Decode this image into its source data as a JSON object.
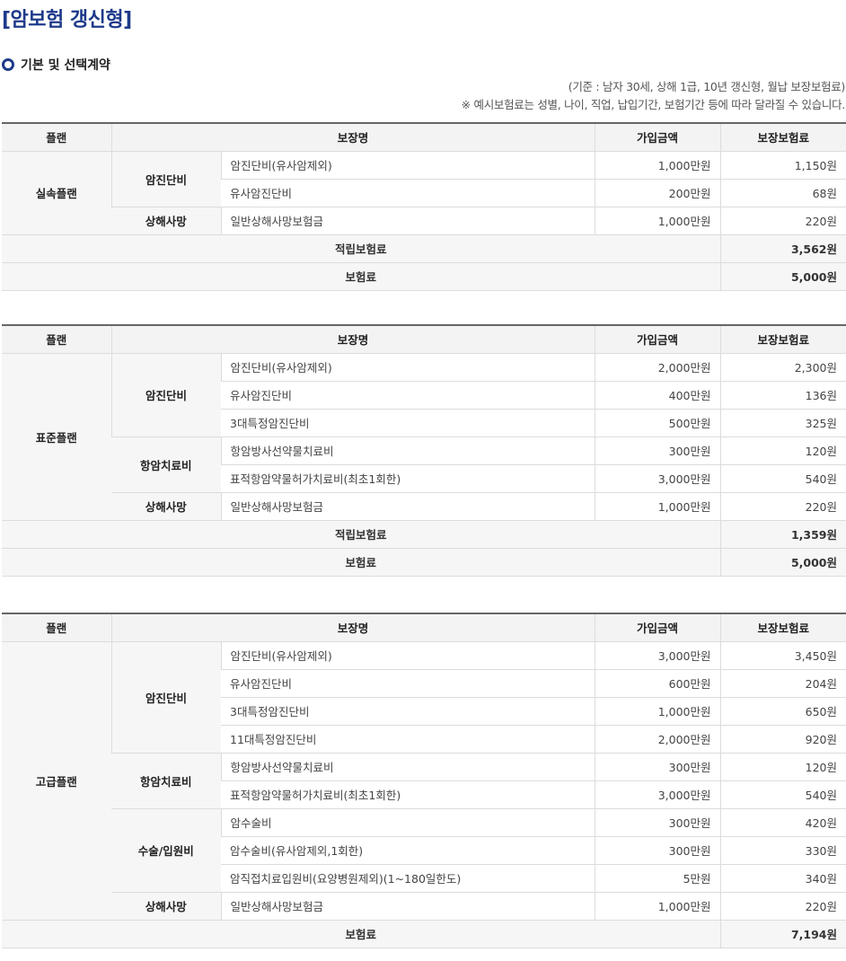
{
  "page_title": "[암보험 갱신형]",
  "section_label": "기본 및 선택계약",
  "note_basis": "(기준 : 남자 30세, 상해 1급, 10년 갱신형, 월납 보장보험료)",
  "note_disclaimer": "※ 예시보험료는 성별, 나이, 직업, 납입기간, 보험기간 등에 따라 달라질 수 있습니다.",
  "headers": {
    "plan": "플랜",
    "coverage": "보장명",
    "amount": "가입금액",
    "premium": "보장보험료"
  },
  "plans": [
    {
      "name": "실속플랜",
      "groups": [
        {
          "category": "암진단비",
          "items": [
            {
              "coverage": "암진단비(유사암제외)",
              "amount": "1,000만원",
              "premium": "1,150원"
            },
            {
              "coverage": "유사암진단비",
              "amount": "200만원",
              "premium": "68원"
            }
          ]
        },
        {
          "category": "상해사망",
          "items": [
            {
              "coverage": "일반상해사망보험금",
              "amount": "1,000만원",
              "premium": "220원"
            }
          ]
        }
      ],
      "totals": [
        {
          "label": "적립보험료",
          "value": "3,562원"
        },
        {
          "label": "보험료",
          "value": "5,000원"
        }
      ]
    },
    {
      "name": "표준플랜",
      "groups": [
        {
          "category": "암진단비",
          "items": [
            {
              "coverage": "암진단비(유사암제외)",
              "amount": "2,000만원",
              "premium": "2,300원"
            },
            {
              "coverage": "유사암진단비",
              "amount": "400만원",
              "premium": "136원"
            },
            {
              "coverage": "3대특정암진단비",
              "amount": "500만원",
              "premium": "325원"
            }
          ]
        },
        {
          "category": "항암치료비",
          "items": [
            {
              "coverage": "항암방사선약물치료비",
              "amount": "300만원",
              "premium": "120원"
            },
            {
              "coverage": "표적항암약물허가치료비(최초1회한)",
              "amount": "3,000만원",
              "premium": "540원"
            }
          ]
        },
        {
          "category": "상해사망",
          "items": [
            {
              "coverage": "일반상해사망보험금",
              "amount": "1,000만원",
              "premium": "220원"
            }
          ]
        }
      ],
      "totals": [
        {
          "label": "적립보험료",
          "value": "1,359원"
        },
        {
          "label": "보험료",
          "value": "5,000원"
        }
      ]
    },
    {
      "name": "고급플랜",
      "groups": [
        {
          "category": "암진단비",
          "items": [
            {
              "coverage": "암진단비(유사암제외)",
              "amount": "3,000만원",
              "premium": "3,450원"
            },
            {
              "coverage": "유사암진단비",
              "amount": "600만원",
              "premium": "204원"
            },
            {
              "coverage": "3대특정암진단비",
              "amount": "1,000만원",
              "premium": "650원"
            },
            {
              "coverage": "11대특정암진단비",
              "amount": "2,000만원",
              "premium": "920원"
            }
          ]
        },
        {
          "category": "항암치료비",
          "items": [
            {
              "coverage": "항암방사선약물치료비",
              "amount": "300만원",
              "premium": "120원"
            },
            {
              "coverage": "표적항암약물허가치료비(최초1회한)",
              "amount": "3,000만원",
              "premium": "540원"
            }
          ]
        },
        {
          "category": "수술/입원비",
          "items": [
            {
              "coverage": "암수술비",
              "amount": "300만원",
              "premium": "420원"
            },
            {
              "coverage": "암수술비(유사암제외,1회한)",
              "amount": "300만원",
              "premium": "330원"
            },
            {
              "coverage": "암직접치료입원비(요양병원제외)(1~180일한도)",
              "amount": "5만원",
              "premium": "340원"
            }
          ]
        },
        {
          "category": "상해사망",
          "items": [
            {
              "coverage": "일반상해사망보험금",
              "amount": "1,000만원",
              "premium": "220원"
            }
          ]
        }
      ],
      "totals": [
        {
          "label": "보험료",
          "value": "7,194원"
        }
      ]
    }
  ]
}
